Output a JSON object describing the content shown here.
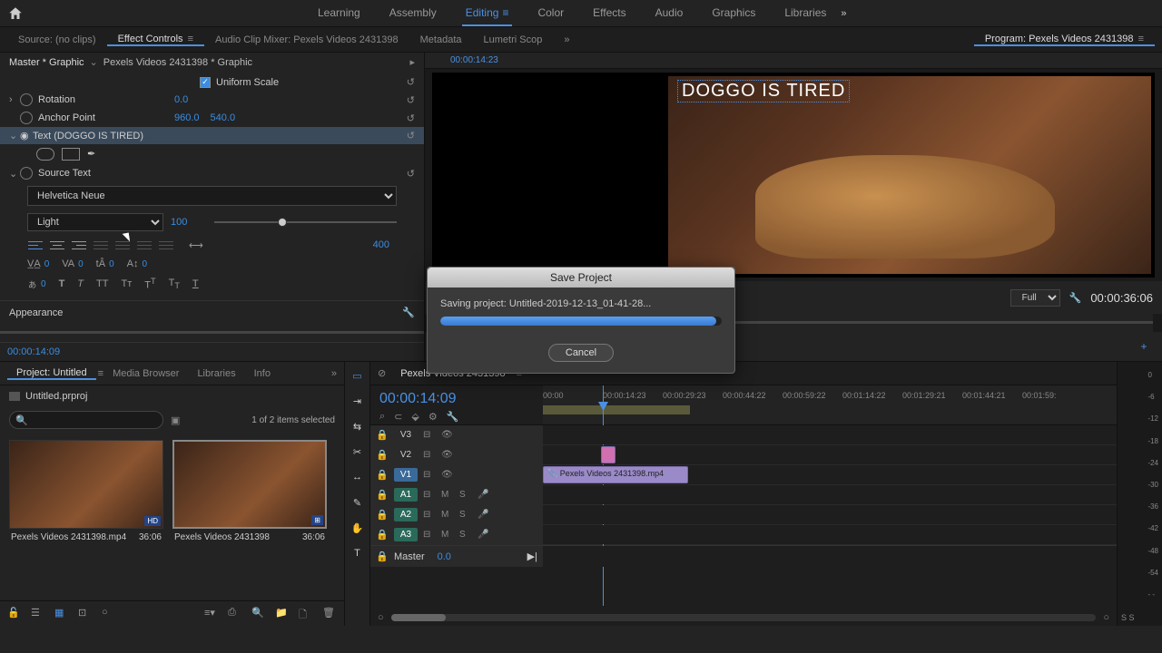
{
  "topbar": {
    "workspaces": [
      "Learning",
      "Assembly",
      "Editing",
      "Color",
      "Effects",
      "Audio",
      "Graphics",
      "Libraries"
    ],
    "active_workspace": "Editing"
  },
  "source_tabs": {
    "items": [
      "Source: (no clips)",
      "Effect Controls",
      "Audio Clip Mixer: Pexels Videos 2431398",
      "Metadata",
      "Lumetri Scop"
    ],
    "active": "Effect Controls"
  },
  "program_tab": "Program: Pexels Videos 2431398",
  "breadcrumb": {
    "master": "Master * Graphic",
    "clip": "Pexels Videos 2431398 * Graphic"
  },
  "mini_timecode": "00:00:14:23",
  "props": {
    "uniform_scale": "Uniform Scale",
    "rotation": {
      "label": "Rotation",
      "value": "0.0"
    },
    "anchor": {
      "label": "Anchor Point",
      "x": "960.0",
      "y": "540.0"
    },
    "text_layer": "Text (DOGGO IS TIRED)",
    "source_text": "Source Text",
    "font": "Helvetica Neue",
    "weight": "Light",
    "size": "100",
    "tracking": "400",
    "va1": "0",
    "va2": "0",
    "va3": "0",
    "va4": "0",
    "va5": "0",
    "appearance": "Appearance"
  },
  "effect_tc": "00:00:14:09",
  "overlay_text": "DOGGO IS TIRED",
  "program": {
    "resolution": "Full",
    "duration": "00:00:36:06"
  },
  "project_tabs": [
    "Project: Untitled",
    "Media Browser",
    "Libraries",
    "Info"
  ],
  "project_name": "Untitled.prproj",
  "search_placeholder": "",
  "selection_info": "1 of 2 items selected",
  "bins": [
    {
      "name": "Pexels Videos 2431398.mp4",
      "dur": "36:06",
      "selected": false
    },
    {
      "name": "Pexels Videos 2431398",
      "dur": "36:06",
      "selected": true
    }
  ],
  "timeline": {
    "sequence": "Pexels Videos 2431398",
    "timecode": "00:00:14:09",
    "ruler": [
      "00:00",
      "00:00:14:23",
      "00:00:29:23",
      "00:00:44:22",
      "00:00:59:22",
      "00:01:14:22",
      "00:01:29:21",
      "00:01:44:21",
      "00:01:59:"
    ],
    "tracks_v": [
      "V3",
      "V2",
      "V1"
    ],
    "tracks_a": [
      "A1",
      "A2",
      "A3"
    ],
    "clip_name": "Pexels Videos 2431398.mp4",
    "master": "Master",
    "master_val": "0.0"
  },
  "meter_marks": [
    "0",
    "-6",
    "-12",
    "-18",
    "-24",
    "-30",
    "-36",
    "-42",
    "-48",
    "-54",
    "- -"
  ],
  "meter_footer": "S  S",
  "modal": {
    "title": "Save Project",
    "message": "Saving project: Untitled-2019-12-13_01-41-28...",
    "cancel": "Cancel"
  }
}
